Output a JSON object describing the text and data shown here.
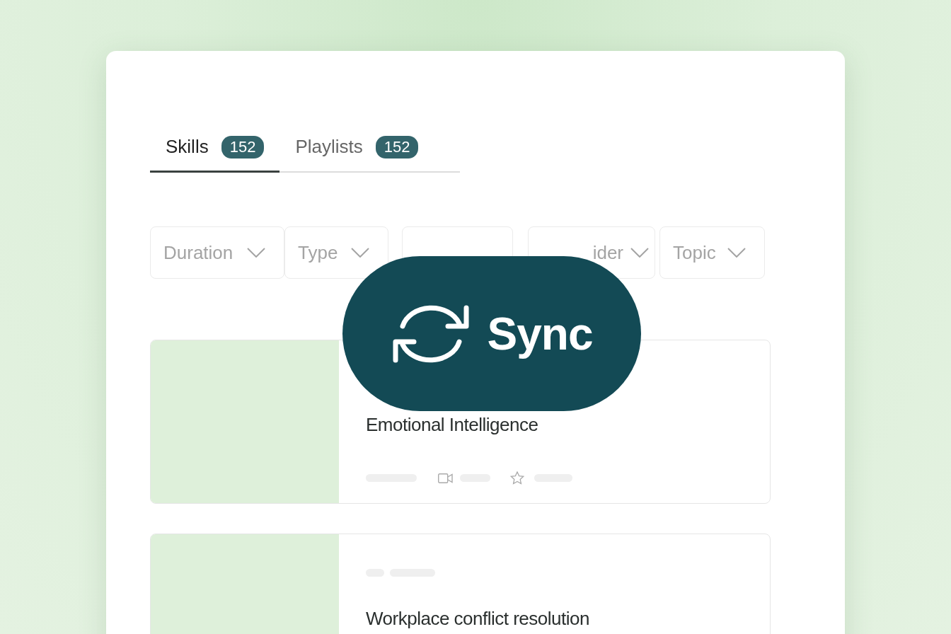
{
  "tabs": [
    {
      "label": "Skills",
      "count": "152",
      "selected": true
    },
    {
      "label": "Playlists",
      "count": "152",
      "selected": false
    }
  ],
  "filters": [
    {
      "kind": "dropdown",
      "label": "Duration"
    },
    {
      "kind": "dropdown",
      "label": "Type"
    },
    {
      "kind": "blank"
    },
    {
      "kind": "dropdown",
      "label": "ider"
    },
    {
      "kind": "dropdown",
      "label": "Topic"
    }
  ],
  "courses": [
    {
      "kind": "details",
      "title": "Emotional Intelligence"
    },
    {
      "kind": "tags",
      "title": "Workplace conflict resolution"
    }
  ],
  "overlay": {
    "label": "Sync"
  }
}
